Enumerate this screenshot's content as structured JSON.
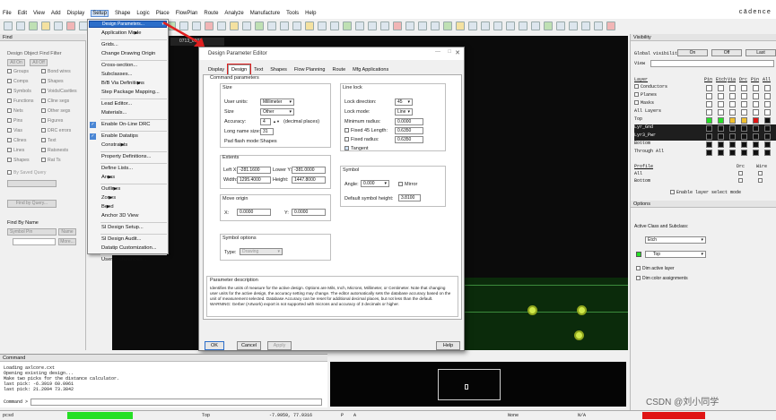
{
  "menubar": {
    "items": [
      "File",
      "Edit",
      "View",
      "Add",
      "Display",
      "Setup",
      "Shape",
      "Logic",
      "Place",
      "FlowPlan",
      "Route",
      "Analyze",
      "Manufacture",
      "Tools",
      "Help"
    ],
    "brand": "cādence"
  },
  "file_tab": "0713_0907",
  "find_panel": {
    "header": "Find",
    "filter_title": "Design Object Find Filter",
    "all_on": "All On",
    "all_off": "All Off",
    "left_items": [
      "Groups",
      "Comps",
      "Symbols",
      "Functions",
      "Nets",
      "Pins",
      "Vias",
      "Clines",
      "Lines",
      "Shapes"
    ],
    "right_items": [
      "Bond wires",
      "Shapes",
      "Voids/Cavities",
      "Cline segs",
      "Other segs",
      "Figures",
      "DRC errors",
      "Text",
      "Ratsnests",
      "Rat Ts"
    ],
    "by_saved_query": "By Saved Query",
    "find_by_query": "Find by Query...",
    "find_by_name": "Find By Name",
    "symbol_pin": "Symbol Pin",
    "name_btn": "Name",
    "more_btn": "More..."
  },
  "setup_menu": {
    "items": [
      {
        "label": "Design Parameters...",
        "selected": true
      },
      {
        "label": "Application Mode",
        "arrow": true
      },
      {
        "label": "Grids..."
      },
      {
        "label": "Change Drawing Origin"
      },
      {
        "label": "Cross-section..."
      },
      {
        "label": "Subclasses..."
      },
      {
        "label": "B/B Via Definitions",
        "arrow": true
      },
      {
        "label": "Step Package Mapping..."
      },
      {
        "label": "Lead Editor..."
      },
      {
        "label": "Materials..."
      },
      {
        "label": "Enable On-Line DRC",
        "checked": true
      },
      {
        "label": "Enable Datatips",
        "checked": true
      },
      {
        "label": "Constraints",
        "arrow": true
      },
      {
        "label": "Property Definitions..."
      },
      {
        "label": "Define Lists..."
      },
      {
        "label": "Areas",
        "arrow": true
      },
      {
        "label": "Outlines",
        "arrow": true
      },
      {
        "label": "Zones",
        "arrow": true
      },
      {
        "label": "Bend",
        "arrow": true
      },
      {
        "label": "Anchor 3D View"
      },
      {
        "label": "SI Design Setup..."
      },
      {
        "label": "SI Design Audit..."
      },
      {
        "label": "Datatip Customization..."
      },
      {
        "label": "User Preferences..."
      }
    ]
  },
  "dialog": {
    "title": "Design Parameter Editor",
    "tabs": [
      "Display",
      "Design",
      "Text",
      "Shapes",
      "Flow Planning",
      "Route",
      "Mfg Applications"
    ],
    "active_tab": "Design",
    "command_parameters": "Command parameters",
    "size": {
      "title": "Size",
      "user_units_label": "User units:",
      "user_units": "Millimeter",
      "size_label": "Size",
      "size": "Other",
      "accuracy_label": "Accuracy:",
      "accuracy": "4",
      "decimal_places": "(decimal places)",
      "long_name_size_label": "Long name size:",
      "long_name_size": "31",
      "pad_flash_mode_label": "Pad flash mode:",
      "pad_flash_mode": "Shapes"
    },
    "extents": {
      "title": "Extents",
      "left_x_label": "Left X:",
      "left_x": "-281.1600",
      "lower_y_label": "Lower Y:",
      "lower_y": "-381.0000",
      "width_label": "Width:",
      "width": "1295.4000",
      "height_label": "Height:",
      "height": "1447.8000"
    },
    "move_origin": {
      "title": "Move origin",
      "x_label": "X:",
      "x": "0.0000",
      "y_label": "Y:",
      "y": "0.0000"
    },
    "symbol_options": {
      "title": "Symbol options",
      "type_label": "Type:",
      "type": "Drawing"
    },
    "line_lock": {
      "title": "Line lock",
      "direction_label": "Lock direction:",
      "direction": "45",
      "mode_label": "Lock mode:",
      "mode": "Line",
      "min_radius_label": "Minimum radius:",
      "min_radius": "0.0000",
      "fixed45_label": "Fixed 45 Length:",
      "fixed45": "0.6350",
      "fixed_radius_label": "Fixed radius:",
      "fixed_radius": "0.6350",
      "tangent_label": "Tangent"
    },
    "symbol": {
      "title": "Symbol",
      "angle_label": "Angle:",
      "angle": "0.000",
      "mirror_label": "Mirror",
      "default_height_label": "Default symbol height:",
      "default_height": "3.8100"
    },
    "param_desc_title": "Parameter description",
    "param_desc": "Identifies the units of measure for the active design. Options are Mils, Inch, Microns, Millimeter, or Centimeter. Note that changing user units for the active design, the accuracy setting may change. The editor automatically sets the database accuracy based on the unit of measurement selected. Database Accuracy can be reset for additional decimal places, but not less than the default. WARNING: Gerber (Artwork) export is not supported with microns and accuracy of 3 decimals or higher.",
    "ok": "OK",
    "cancel": "Cancel",
    "apply": "Apply",
    "help": "Help"
  },
  "visibility": {
    "header": "Visibility",
    "global_label": "Global visibility",
    "on": "On",
    "off": "Off",
    "last": "Last",
    "view_label": "View",
    "columns": [
      "Pin",
      "Etch",
      "Via",
      "Drc",
      "Pin",
      "All"
    ],
    "layer_title": "Layer",
    "rows": [
      "Conductors",
      "Planes",
      "Masks",
      "All Layers",
      "Top",
      "Lyr_Gnd",
      "Lyr3_Pwr",
      "Bottom",
      "Through All"
    ],
    "profile_title": "Profile",
    "profile_cols": [
      "Drc",
      "Wire"
    ],
    "profile_rows": [
      "All",
      "Bottom"
    ],
    "enable_layer_select": "Enable layer select mode"
  },
  "options": {
    "header": "Options",
    "active_class_label": "Active Class and Subclass:",
    "class": "Etch",
    "subclass": "Top",
    "dim_active_layer": "Dim active layer",
    "dim_color_assignments": "Dim color assignments"
  },
  "console": {
    "header": "Command",
    "lines": [
      "Loading axlcore.cxt",
      "Opening existing design...",
      "Make two picks for the distance calculator.",
      "last pick:   -6.3919 60.0961",
      "last pick:   21.2094 73.3842"
    ],
    "prompt": "Command >"
  },
  "status": {
    "mode": "pcsd",
    "layer": "Top",
    "coords": "-7.9959, 77.9316",
    "p": "P",
    "a": "A",
    "none": "None",
    "na": "N/A",
    "watermark": "CSDN @刘小同学"
  },
  "colors": {
    "selection": "#2c6ec9",
    "status_green": "#25e025",
    "status_red": "#e01515",
    "canvas": "#0b0b0b",
    "pad": "#cfe94a",
    "callout": "#e02020"
  }
}
